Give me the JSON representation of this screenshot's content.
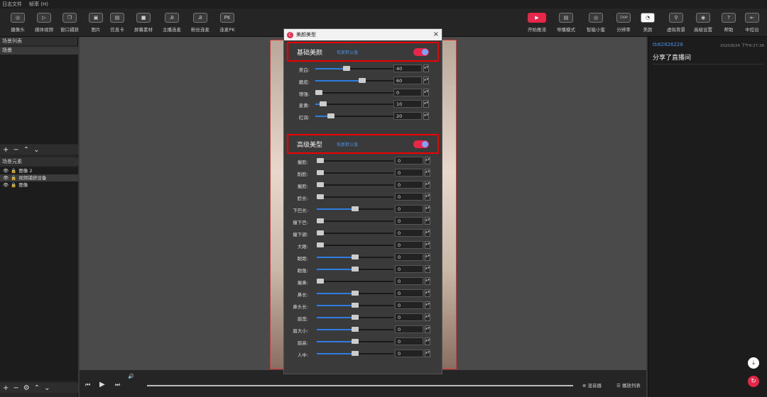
{
  "menu": [
    "日志文件",
    "帧率 (H)"
  ],
  "toolbar_left": [
    "摄像头",
    "媒体视频",
    "窗口捕获",
    "图片",
    "信息卡",
    "屏幕素材",
    "主播连麦",
    "粉丝连麦",
    "连麦PK"
  ],
  "toolbar_right": [
    "开始推流",
    "导播模式",
    "智能小蜜",
    "分辨率",
    "美颜",
    "虚拟背景",
    "高级设置",
    "帮助",
    "中控台"
  ],
  "icons": {
    "pk": "PK",
    "resolution": "720P"
  },
  "left": {
    "scenes_header": "场景列表",
    "scene_selected": "场景",
    "sources_header": "场景元素",
    "sources": [
      "图像 2",
      "视频捕获设备",
      "图像"
    ]
  },
  "right": {
    "user": "tb62826228",
    "time": "2020/8/24 下午8:27:38",
    "message": "分享了直播间"
  },
  "bottom": {
    "mixer": "混音器",
    "playlist": "播放列表"
  },
  "dialog": {
    "title": "美颜美型",
    "basic": {
      "title": "基础美颜",
      "reset": "恢复默认值",
      "sliders": [
        {
          "label": "美白:",
          "value": "40",
          "frac": 0.4
        },
        {
          "label": "磨皮:",
          "value": "60",
          "frac": 0.6
        },
        {
          "label": "增强:",
          "value": "0",
          "frac": 0
        },
        {
          "label": "麦黄:",
          "value": "10",
          "frac": 0.1
        },
        {
          "label": "红润:",
          "value": "20",
          "frac": 0.2
        }
      ]
    },
    "advanced": {
      "title": "高级美型",
      "reset": "恢复默认值",
      "sliders": [
        {
          "label": "瘦脸:",
          "value": "0",
          "frac": 0
        },
        {
          "label": "削脸:",
          "value": "0",
          "frac": 0
        },
        {
          "label": "瘦脸:",
          "value": "0",
          "frac": 0
        },
        {
          "label": "脸长:",
          "value": "0",
          "frac": 0
        },
        {
          "label": "下巴长:",
          "value": "0",
          "frac": 0.5
        },
        {
          "label": "瘦下巴:",
          "value": "0",
          "frac": 0
        },
        {
          "label": "瘦下颌:",
          "value": "0",
          "frac": 0
        },
        {
          "label": "大眼:",
          "value": "0",
          "frac": 0
        },
        {
          "label": "眼距:",
          "value": "0",
          "frac": 0.5
        },
        {
          "label": "眼角:",
          "value": "0",
          "frac": 0.5
        },
        {
          "label": "瘦鼻:",
          "value": "0",
          "frac": 0
        },
        {
          "label": "鼻长:",
          "value": "0",
          "frac": 0.5
        },
        {
          "label": "鼻头长:",
          "value": "0",
          "frac": 0.5
        },
        {
          "label": "眉宽:",
          "value": "0",
          "frac": 0.5
        },
        {
          "label": "眉大小:",
          "value": "0",
          "frac": 0.5
        },
        {
          "label": "眉高:",
          "value": "0",
          "frac": 0.5
        },
        {
          "label": "人中:",
          "value": "0",
          "frac": 0.5
        }
      ]
    }
  }
}
